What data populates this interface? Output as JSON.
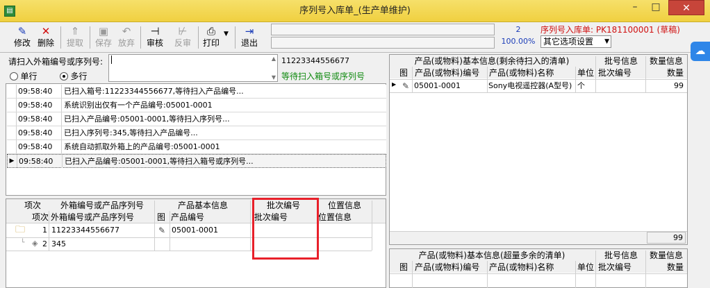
{
  "window": {
    "title": "序列号入库单_(生产单维护)",
    "minimize": "–",
    "maximize": "□",
    "close": "✕"
  },
  "toolbar": {
    "buttons": [
      {
        "name": "modify",
        "label": "修改",
        "icon": "edit-icon",
        "glyph": "✎",
        "enabled": true
      },
      {
        "name": "delete",
        "label": "删除",
        "icon": "delete-icon",
        "glyph": "✕",
        "enabled": true
      },
      {
        "name": "extract",
        "label": "提取",
        "icon": "extract-icon",
        "glyph": "⇑",
        "enabled": false
      },
      {
        "name": "save",
        "label": "保存",
        "icon": "save-icon",
        "glyph": "▣",
        "enabled": false
      },
      {
        "name": "discard",
        "label": "放弃",
        "icon": "undo-icon",
        "glyph": "↶",
        "enabled": false
      },
      {
        "name": "audit",
        "label": "审核",
        "icon": "audit-icon",
        "glyph": "⊣",
        "enabled": true
      },
      {
        "name": "unaudit",
        "label": "反审",
        "icon": "unaudit-icon",
        "glyph": "⊬",
        "enabled": false
      },
      {
        "name": "print",
        "label": "打印",
        "icon": "printer-icon",
        "glyph": "⎙",
        "enabled": true
      },
      {
        "name": "exit",
        "label": "退出",
        "icon": "exit-icon",
        "glyph": "⇥",
        "enabled": true
      }
    ],
    "count": "2",
    "zoom": "100.00%",
    "doc_label": "序列号入库单:",
    "doc_number": "PK181100001",
    "doc_status": "(草稿)",
    "options_select": "其它选项设置"
  },
  "scan": {
    "label": "请扫入外箱编号或序列号:",
    "input_value": "",
    "last_scanned": "11223344556677",
    "hint": "等待扫入箱号或序列号",
    "mode_single": "单行",
    "mode_multi": "多行",
    "selected_mode": "multi"
  },
  "log": [
    {
      "time": "09:58:40",
      "message": "已扫入箱号:11223344556677,等待扫入产品编号..."
    },
    {
      "time": "09:58:40",
      "message": "系统识别出仅有一个产品编号:05001-0001"
    },
    {
      "time": "09:58:40",
      "message": "已扫入产品编号:05001-0001,等待扫入序列号..."
    },
    {
      "time": "09:58:40",
      "message": "已扫入序列号:345,等待扫入产品编号..."
    },
    {
      "time": "09:58:40",
      "message": "系统自动抓取外箱上的产品编号:05001-0001"
    },
    {
      "time": "09:58:40",
      "message": "已扫入产品编号:05001-0001,等待扫入箱号或序列号..."
    }
  ],
  "detail": {
    "group_headers": {
      "index": "项次",
      "box_serial": "外箱编号或产品序列号",
      "product_info": "产品基本信息",
      "batch": "批次编号",
      "location": "位置信息"
    },
    "sub_headers": {
      "index": "项次",
      "box_serial": "外箱编号或产品序列号",
      "image": "图",
      "product_code": "产品编号",
      "batch": "批次编号",
      "location": "位置信息"
    },
    "rows": [
      {
        "index": "1",
        "box_serial": "11223344556677",
        "product_code": "05001-0001"
      },
      {
        "index": "2",
        "box_serial": "345",
        "product_code": ""
      }
    ]
  },
  "pending": {
    "group_headers": {
      "product": "产品(或物料)基本信息(剩余待扫入的清单)",
      "batch": "批号信息",
      "quantity": "数量信息"
    },
    "sub_headers": {
      "image": "图",
      "code": "产品(或物料)编号",
      "name": "产品(或物料)名称",
      "unit": "单位",
      "batch": "批次编号",
      "quantity": "数量"
    },
    "rows": [
      {
        "code": "05001-0001",
        "name": "Sony电视遥控器(A型号)",
        "unit": "个",
        "batch": "",
        "quantity": "99"
      }
    ],
    "total": "99"
  },
  "excess": {
    "group_headers": {
      "product": "产品(或物料)基本信息(超量多余的清单)",
      "batch": "批号信息",
      "quantity": "数量信息"
    },
    "sub_headers": {
      "image": "图",
      "code": "产品(或物料)编号",
      "name": "产品(或物料)名称",
      "unit": "单位",
      "batch": "批次编号",
      "quantity": "数量"
    }
  }
}
